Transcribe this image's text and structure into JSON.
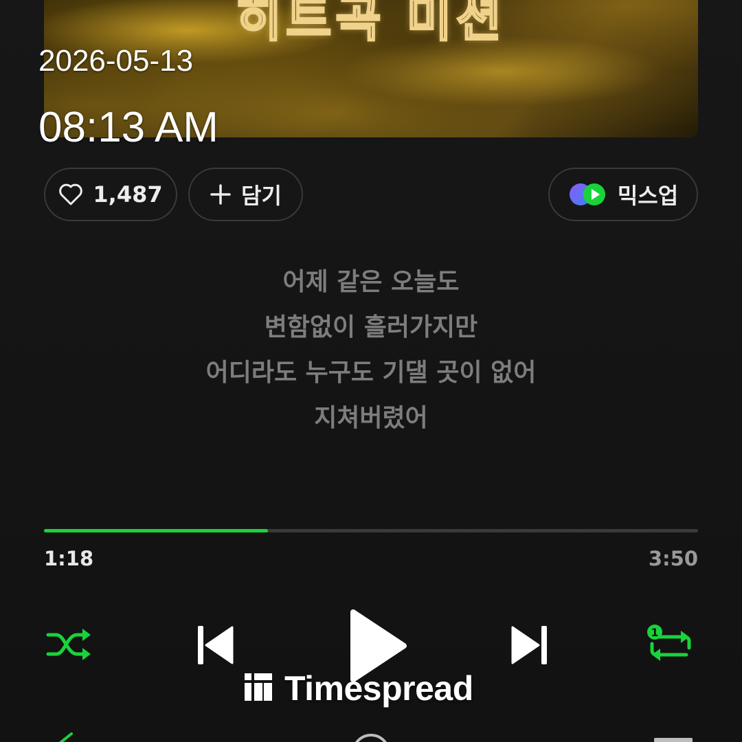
{
  "album": {
    "art_title": "히트곡 미션"
  },
  "overlay": {
    "date": "2026-05-13",
    "time": "08:13 AM"
  },
  "actions": {
    "like_count": "1,487",
    "add_label": "담기",
    "mixup_label": "믹스업"
  },
  "lyrics": [
    "어제 같은 오늘도",
    "변함없이 흘러가지만",
    "어디라도 누구도 기댈 곳이 없어",
    "지쳐버렸어"
  ],
  "playback": {
    "elapsed": "1:18",
    "total": "3:50",
    "progress_fraction": 0.342,
    "repeat_mode_badge": "1"
  },
  "colors": {
    "accent": "#19d33a",
    "lyric_text": "#7d7d7d",
    "background": "#141414"
  },
  "icons": {
    "like": "heart-outline-icon",
    "add": "plus-icon",
    "mixup": "mixup-logo-icon",
    "shuffle": "shuffle-icon",
    "prev": "skip-previous-icon",
    "play": "play-icon",
    "next": "skip-next-icon",
    "repeat": "repeat-one-icon"
  },
  "watermark": {
    "text": "Timespread"
  }
}
